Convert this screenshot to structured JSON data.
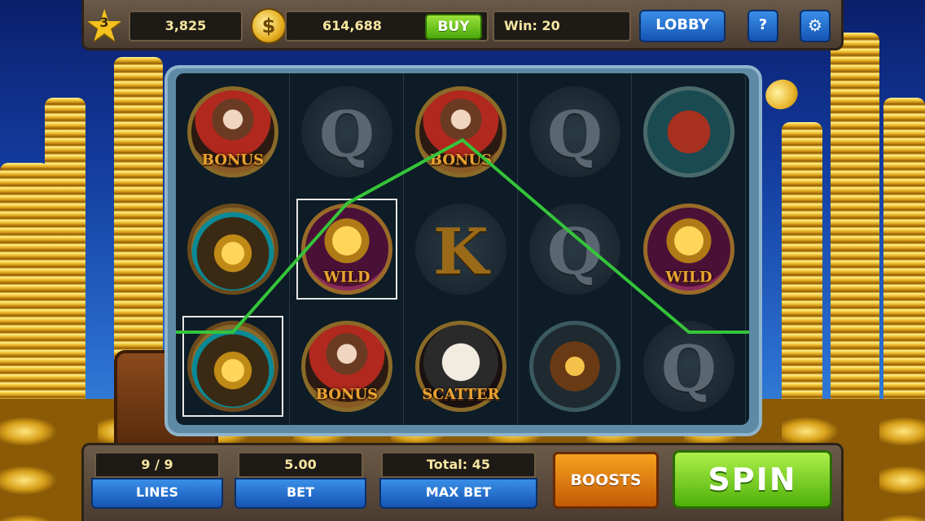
{
  "header": {
    "level": "3",
    "xp": "3,825",
    "coin_symbol": "$",
    "coins": "614,688",
    "buy_label": "BUY",
    "win_text": "Win: 20",
    "lobby_label": "LOBBY",
    "help_label": "?",
    "settings_icon": "gear-icon"
  },
  "reels": [
    [
      {
        "symbol": "bonus",
        "label": "BONUS"
      },
      {
        "symbol": "gold-pan",
        "label": ""
      },
      {
        "symbol": "gold-pan",
        "label": ""
      }
    ],
    [
      {
        "symbol": "queen",
        "label": "Q"
      },
      {
        "symbol": "wild",
        "label": "WILD"
      },
      {
        "symbol": "bonus",
        "label": "BONUS"
      }
    ],
    [
      {
        "symbol": "bonus",
        "label": "BONUS"
      },
      {
        "symbol": "king",
        "label": "K"
      },
      {
        "symbol": "scatter",
        "label": "SCATTER"
      }
    ],
    [
      {
        "symbol": "queen",
        "label": "Q"
      },
      {
        "symbol": "queen",
        "label": "Q"
      },
      {
        "symbol": "lantern",
        "label": ""
      }
    ],
    [
      {
        "symbol": "dynamite",
        "label": ""
      },
      {
        "symbol": "wild",
        "label": "WILD"
      },
      {
        "symbol": "queen",
        "label": "Q"
      }
    ]
  ],
  "footer": {
    "lines_value": "9 / 9",
    "lines_label": "LINES",
    "bet_value": "5.00",
    "bet_label": "BET",
    "total_text": "Total: 45",
    "maxbet_label": "MAX BET",
    "boosts_label": "BOOSTS",
    "spin_label": "SPIN"
  },
  "colors": {
    "payline": "#35c43a",
    "spin_button": "#4fb00a",
    "boosts_button": "#e07a10",
    "blue_button": "#1e6fd0"
  }
}
